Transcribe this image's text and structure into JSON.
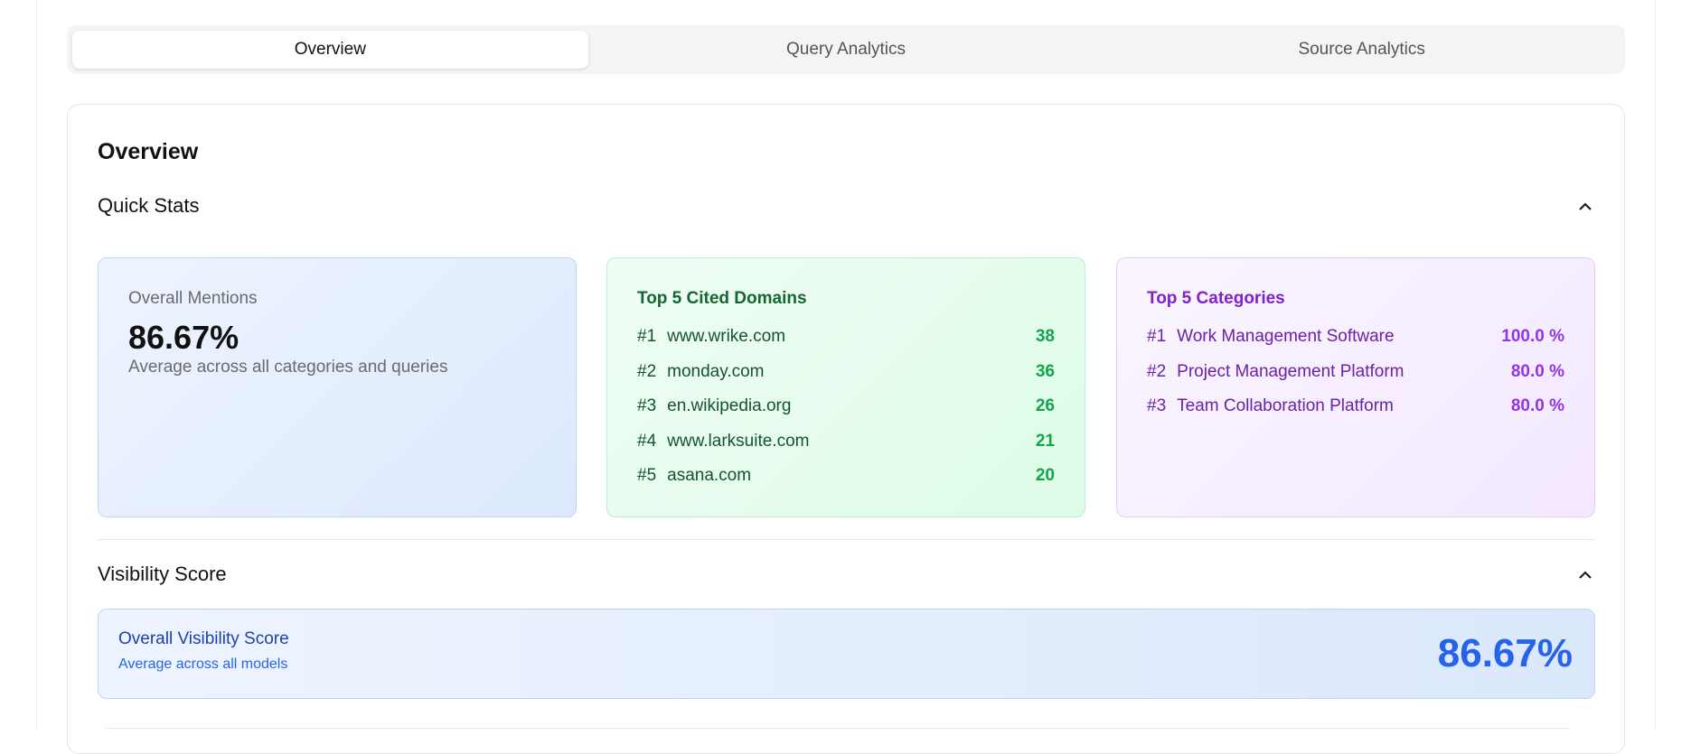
{
  "tabs": [
    {
      "label": "Overview",
      "active": true
    },
    {
      "label": "Query Analytics",
      "active": false
    },
    {
      "label": "Source Analytics",
      "active": false
    }
  ],
  "overview": {
    "title": "Overview",
    "quick_stats": {
      "header": "Quick Stats",
      "mentions": {
        "label": "Overall Mentions",
        "value": "86.67%",
        "sub": "Average across all categories and queries"
      },
      "domains": {
        "heading": "Top 5 Cited Domains",
        "items": [
          {
            "rank": "#1",
            "name": "www.wrike.com",
            "value": "38"
          },
          {
            "rank": "#2",
            "name": "monday.com",
            "value": "36"
          },
          {
            "rank": "#3",
            "name": "en.wikipedia.org",
            "value": "26"
          },
          {
            "rank": "#4",
            "name": "www.larksuite.com",
            "value": "21"
          },
          {
            "rank": "#5",
            "name": "asana.com",
            "value": "20"
          }
        ]
      },
      "categories": {
        "heading": "Top 5 Categories",
        "items": [
          {
            "rank": "#1",
            "name": "Work Management Software",
            "value": "100.0 %"
          },
          {
            "rank": "#2",
            "name": "Project Management Platform",
            "value": "80.0 %"
          },
          {
            "rank": "#3",
            "name": "Team Collaboration Platform",
            "value": "80.0 %"
          }
        ]
      }
    },
    "visibility": {
      "header": "Visibility Score",
      "title": "Overall Visibility Score",
      "sub": "Average across all models",
      "value": "86.67%"
    }
  },
  "colors": {
    "accent_blue": "#2563eb",
    "green": "#16a34a",
    "purple": "#9333ea"
  },
  "icons": {
    "collapse": "chevron-up-icon"
  }
}
